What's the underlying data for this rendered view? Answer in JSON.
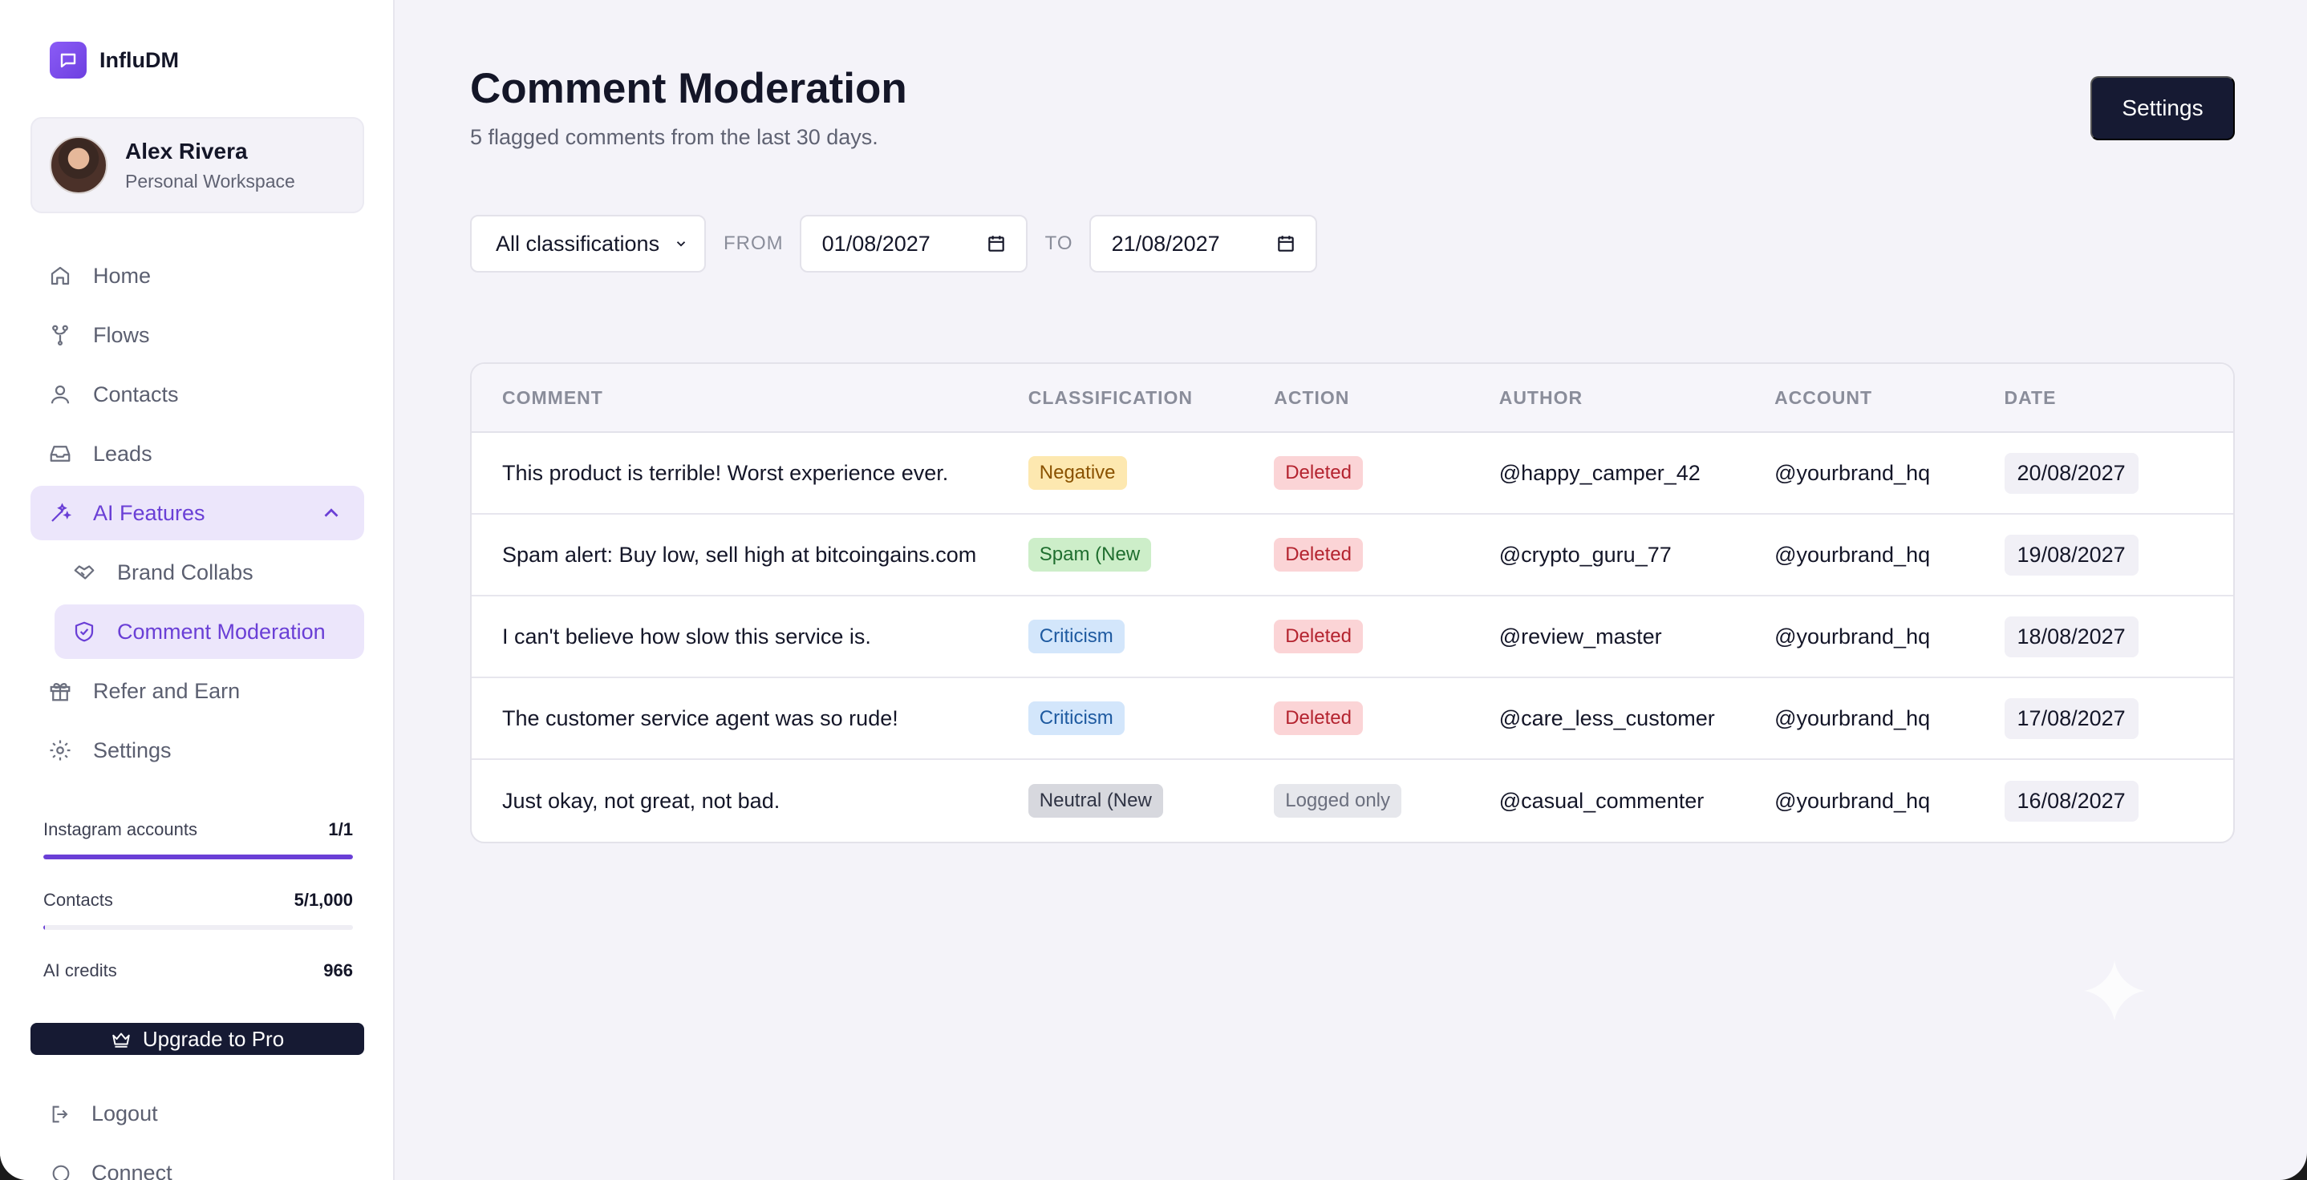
{
  "brand": {
    "name": "InfluDM"
  },
  "profile": {
    "name": "Alex Rivera",
    "workspace": "Personal Workspace"
  },
  "nav": {
    "home": "Home",
    "flows": "Flows",
    "contacts": "Contacts",
    "leads": "Leads",
    "ai_features": "AI Features",
    "brand_collabs": "Brand Collabs",
    "comment_moderation": "Comment Moderation",
    "refer": "Refer and Earn",
    "settings": "Settings"
  },
  "usage": [
    {
      "label": "Instagram accounts",
      "value": "1/1",
      "fraction": 1.0
    },
    {
      "label": "Contacts",
      "value": "5/1,000",
      "fraction": 0.005
    },
    {
      "label": "AI credits",
      "value": "966"
    }
  ],
  "upgrade": {
    "label": "Upgrade to Pro"
  },
  "logout": {
    "label": "Logout"
  },
  "connect": {
    "label": "Connect"
  },
  "page": {
    "title": "Comment Moderation",
    "subtitle": "5 flagged comments from the last 30 days.",
    "settings_label": "Settings"
  },
  "filters": {
    "classification": "All classifications",
    "from_label": "FROM",
    "from_date": "01/08/2027",
    "to_label": "TO",
    "to_date": "21/08/2027"
  },
  "table": {
    "headers": [
      "COMMENT",
      "CLASSIFICATION",
      "ACTION",
      "AUTHOR",
      "ACCOUNT",
      "DATE"
    ],
    "rows": [
      {
        "comment": "This product is terrible! Worst experience ever.",
        "classification": "Negative",
        "action": "Deleted",
        "author": "@happy_camper_42",
        "account": "@yourbrand_hq",
        "date": "20/08/2027"
      },
      {
        "comment": "Spam alert: Buy low, sell high at bitcoingains.com",
        "classification": "Spam (New",
        "action": "Deleted",
        "author": "@crypto_guru_77",
        "account": "@yourbrand_hq",
        "date": "19/08/2027"
      },
      {
        "comment": "I can't believe how slow this service is.",
        "classification": "Criticism",
        "action": "Deleted",
        "author": "@review_master",
        "account": "@yourbrand_hq",
        "date": "18/08/2027"
      },
      {
        "comment": "The customer service agent was so rude!",
        "classification": "Criticism",
        "action": "Deleted",
        "author": "@care_less_customer",
        "account": "@yourbrand_hq",
        "date": "17/08/2027"
      },
      {
        "comment": "Just okay, not great, not bad.",
        "classification": "Neutral (New",
        "action": "Logged only",
        "author": "@casual_commenter",
        "account": "@yourbrand_hq",
        "date": "16/08/2027"
      }
    ]
  },
  "colors": {
    "accent": "#6a3fd6",
    "dark_button": "#161a33",
    "negative": "#fde8b0",
    "spam": "#cdeec9",
    "criticism": "#d3e6fb",
    "neutral": "#d7d8de",
    "deleted": "#fbd4d6",
    "logged": "#e6e7ec"
  }
}
